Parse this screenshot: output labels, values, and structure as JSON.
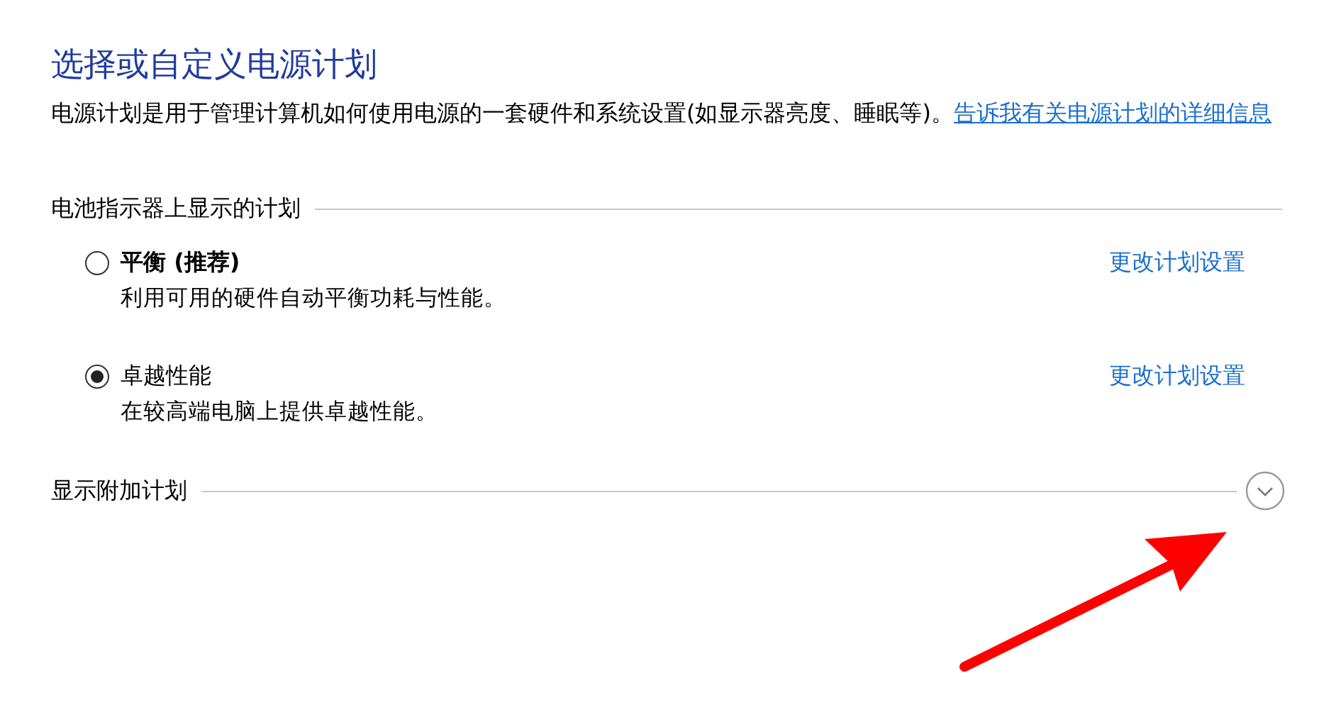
{
  "title": "选择或自定义电源计划",
  "description": "电源计划是用于管理计算机如何使用电源的一套硬件和系统设置(如显示器亮度、睡眠等)。",
  "description_link": "告诉我有关电源计划的详细信息",
  "plan_group": {
    "title": "电池指示器上显示的计划",
    "plans": [
      {
        "name": "平衡 (推荐)",
        "recommended": true,
        "selected": false,
        "detail": "利用可用的硬件自动平衡功耗与性能。",
        "action": "更改计划设置"
      },
      {
        "name": "卓越性能",
        "recommended": false,
        "selected": true,
        "detail": "在较高端电脑上提供卓越性能。",
        "action": "更改计划设置"
      }
    ]
  },
  "additional_plans": {
    "label": "显示附加计划",
    "expanded": false
  }
}
